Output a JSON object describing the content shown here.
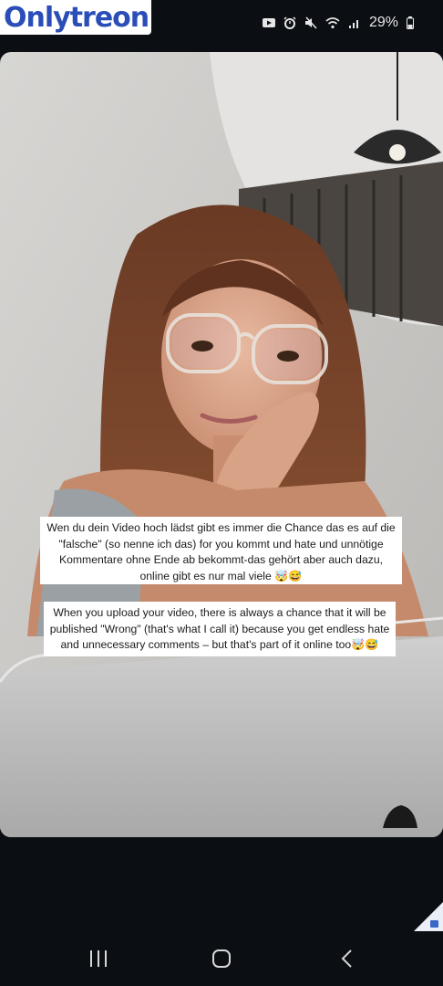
{
  "watermark": {
    "brand_part1": "Only",
    "brand_part2": "treon"
  },
  "status_bar": {
    "battery_percent": "29%",
    "icons": [
      "youtube-icon",
      "alarm-icon",
      "mute-icon",
      "wifi-icon",
      "signal-icon",
      "battery-icon"
    ]
  },
  "post": {
    "caption_de": "Wen du dein Video hoch lädst gibt es immer die Chance das es auf die \"falsche\" (so nenne ich das) for you kommt und hate und unnötige Kommentare ohne Ende ab bekommt-das gehört aber auch dazu, online gibt es nur mal viele 🤯😅",
    "caption_en": "When you upload your video, there is always a chance that it will be published \"Wrong\" (that's what I call it) because you get endless hate and unnecessary comments – but that's part of it online too🤯😅"
  },
  "nav": {
    "icons": [
      "recent-apps-icon",
      "home-icon",
      "back-icon"
    ]
  },
  "colors": {
    "background": "#0b0e13",
    "caption_bg": "#ffffff",
    "watermark_brand": "#2a4db8"
  }
}
